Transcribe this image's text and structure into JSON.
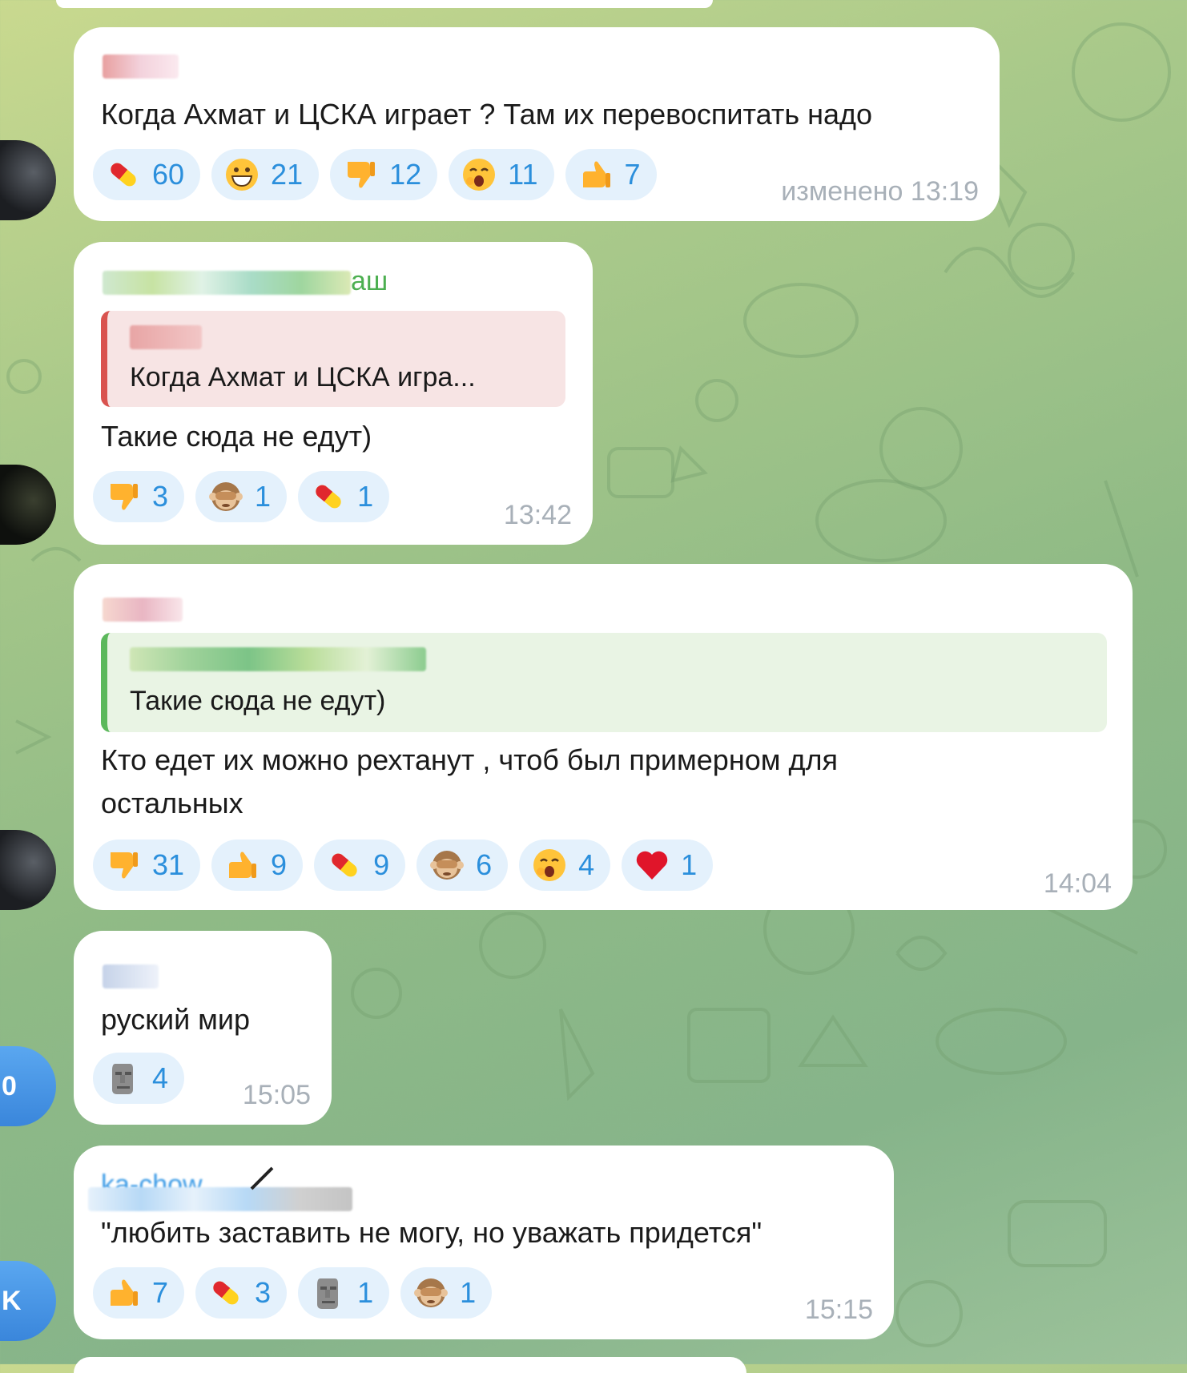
{
  "messages": [
    {
      "text": "Когда Ахмат и ЦСКА играет ? Там их перевоспитать надо",
      "reactions": [
        {
          "emoji": "pill-icon",
          "count": "60"
        },
        {
          "emoji": "grin-icon",
          "count": "21"
        },
        {
          "emoji": "thumbs-down-icon",
          "count": "12"
        },
        {
          "emoji": "yawn-icon",
          "count": "11"
        },
        {
          "emoji": "thumbs-up-icon",
          "count": "7"
        }
      ],
      "time": "изменено 13:19"
    },
    {
      "sender_suffix": "аш",
      "reply_text": "Когда Ахмат и ЦСКА игра...",
      "text": "Такие сюда не едут)",
      "reactions": [
        {
          "emoji": "thumbs-down-icon",
          "count": "3"
        },
        {
          "emoji": "see-no-evil-monkey-icon",
          "count": "1"
        },
        {
          "emoji": "pill-icon",
          "count": "1"
        }
      ],
      "time": "13:42"
    },
    {
      "reply_text": "Такие сюда не едут)",
      "text_line1": "Кто едет их можно рехтанут , чтоб был примерном для",
      "text_line2": "остальных",
      "reactions": [
        {
          "emoji": "thumbs-down-icon",
          "count": "31"
        },
        {
          "emoji": "thumbs-up-icon",
          "count": "9"
        },
        {
          "emoji": "pill-icon",
          "count": "9"
        },
        {
          "emoji": "see-no-evil-monkey-icon",
          "count": "6"
        },
        {
          "emoji": "yawn-icon",
          "count": "4"
        },
        {
          "emoji": "heart-icon",
          "count": "1"
        }
      ],
      "time": "14:04"
    },
    {
      "avatar_letter": "0",
      "text": "руский мир",
      "reactions": [
        {
          "emoji": "moai-icon",
          "count": "4"
        }
      ],
      "time": "15:05"
    },
    {
      "avatar_letter": "K",
      "sender_partial": "ka-chow",
      "text": "\"любить заставить не могу, но уважать придется\"",
      "reactions": [
        {
          "emoji": "thumbs-up-icon",
          "count": "7"
        },
        {
          "emoji": "pill-icon",
          "count": "3"
        },
        {
          "emoji": "moai-icon",
          "count": "1"
        },
        {
          "emoji": "see-no-evil-monkey-icon",
          "count": "1"
        }
      ],
      "time": "15:15"
    }
  ],
  "colors": {
    "reaction_bg": "#e4f1fc",
    "reaction_text": "#2b8fdc",
    "time": "#a8b0b8",
    "reply_red_bar": "#d9534f",
    "reply_green_bar": "#5cb85c"
  }
}
